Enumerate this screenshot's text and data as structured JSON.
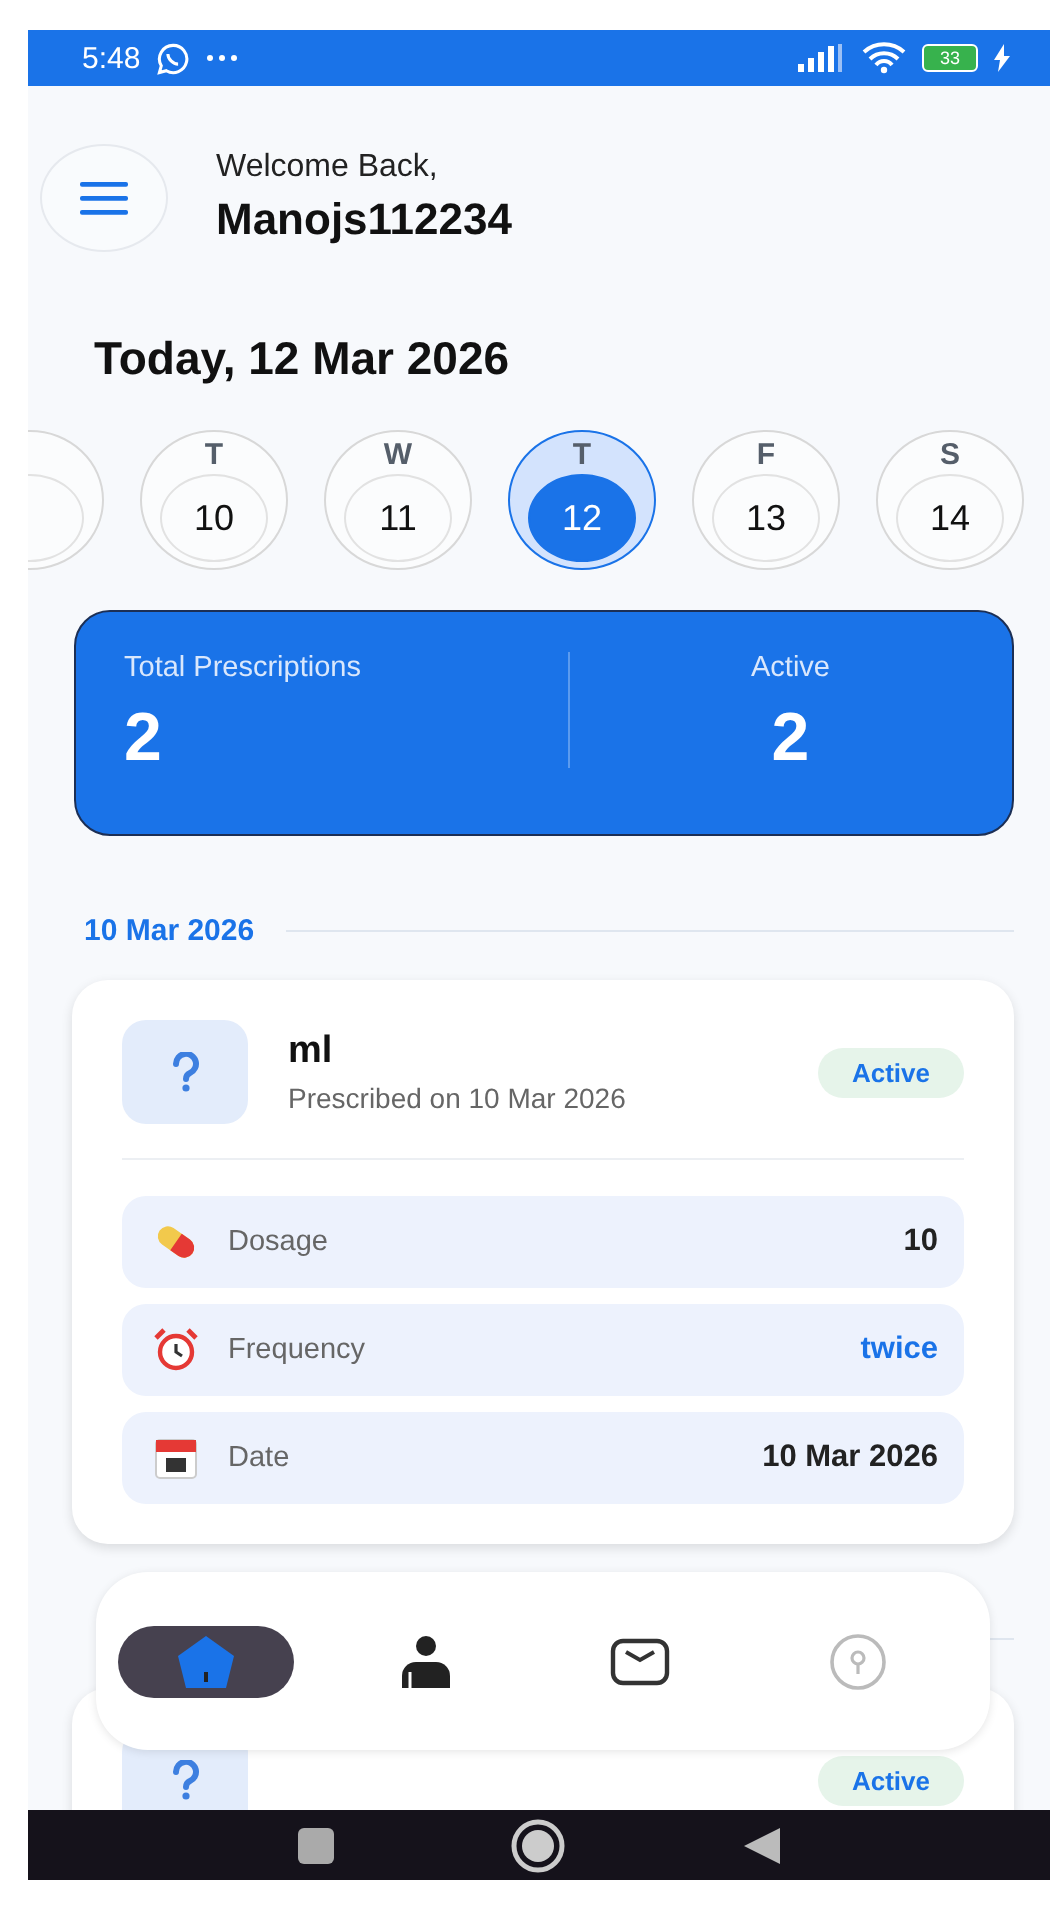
{
  "status_bar": {
    "time": "5:48",
    "battery": "33"
  },
  "header": {
    "greeting": "Welcome Back,",
    "username": "Manojs112234"
  },
  "date_title": "Today, 12 Mar 2026",
  "days": [
    {
      "selected": false
    },
    {
      "letter": "T",
      "day": "10",
      "selected": false
    },
    {
      "letter": "W",
      "day": "11",
      "selected": false
    },
    {
      "letter": "T",
      "day": "12",
      "selected": true
    },
    {
      "letter": "F",
      "day": "13",
      "selected": false
    },
    {
      "letter": "S",
      "day": "14",
      "selected": false
    }
  ],
  "stats": [
    {
      "label": "Total Prescriptions",
      "value": "2"
    },
    {
      "label": "Active",
      "value": "2"
    }
  ],
  "sections": [
    {
      "date": "10 Mar 2026",
      "prescriptions": [
        {
          "name": "ml",
          "prescribed": "Prescribed on 10 Mar 2026",
          "status": "Active",
          "details": [
            {
              "kind": "dosage",
              "label": "Dosage",
              "value": "10"
            },
            {
              "kind": "frequency",
              "label": "Frequency",
              "value": "twice"
            },
            {
              "kind": "date",
              "label": "Date",
              "value": "10 Mar 2026"
            }
          ]
        }
      ]
    },
    {
      "prescriptions": [
        {
          "status": "Active"
        }
      ]
    }
  ],
  "bottom_nav": [
    {
      "kind": "home",
      "selected": true
    },
    {
      "kind": "profile",
      "selected": false
    },
    {
      "kind": "messages",
      "selected": false
    },
    {
      "kind": "location",
      "selected": false
    }
  ]
}
